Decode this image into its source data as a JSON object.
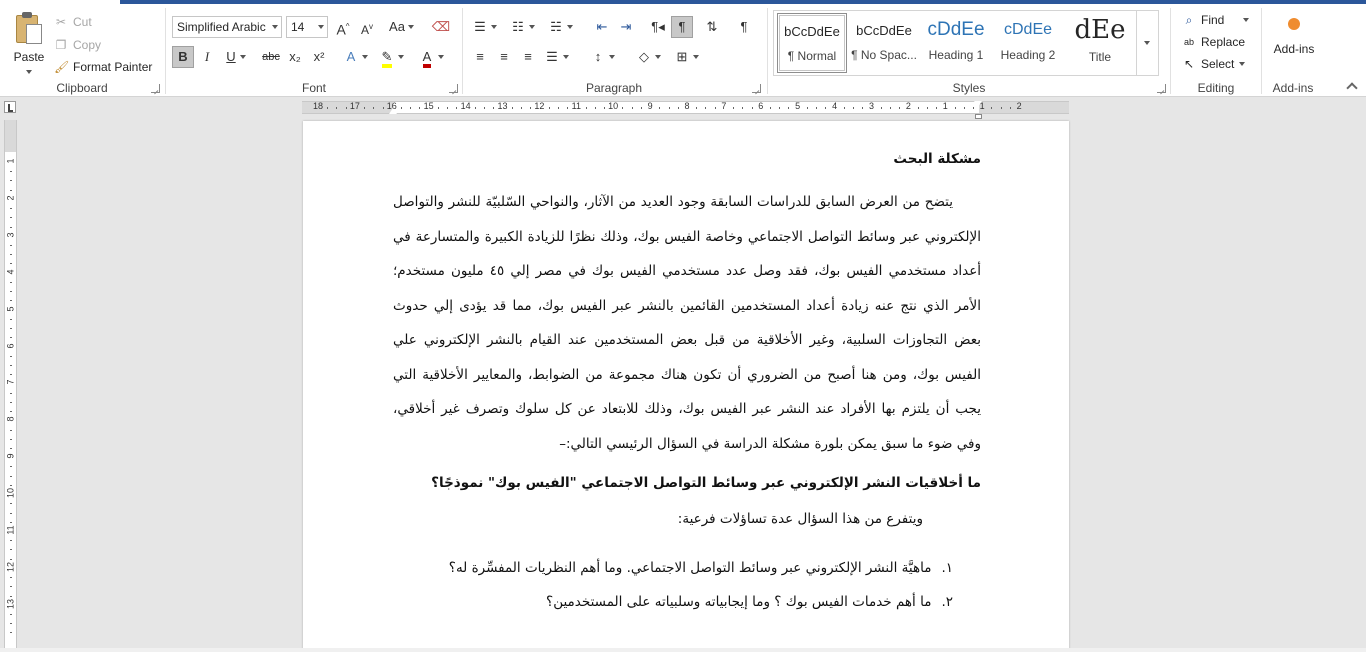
{
  "clipboard": {
    "paste_label": "Paste",
    "cut_label": "Cut",
    "copy_label": "Copy",
    "format_painter_label": "Format Painter",
    "group_label": "Clipboard"
  },
  "font": {
    "family": "Simplified Arabic",
    "size": "14",
    "group_label": "Font",
    "grow_icon": "A^",
    "shrink_icon": "Av",
    "case_label": "Aa",
    "bold": "B",
    "italic": "I",
    "underline": "U",
    "strike": "abc",
    "subscript": "x₂",
    "superscript": "x²",
    "highlight_color": "#ffff00",
    "font_color": "#c00000"
  },
  "paragraph": {
    "group_label": "Paragraph"
  },
  "styles": {
    "group_label": "Styles",
    "items": [
      {
        "sample": "bCcDdEe",
        "name": "¶ Normal"
      },
      {
        "sample": "bCcDdEe",
        "name": "¶ No Spac..."
      },
      {
        "sample": "cDdEe",
        "name": "Heading 1"
      },
      {
        "sample": "cDdEe",
        "name": "Heading 2"
      },
      {
        "sample": "dEe",
        "name": "Title"
      }
    ]
  },
  "editing": {
    "group_label": "Editing",
    "find_label": "Find",
    "replace_label": "Replace",
    "select_label": "Select"
  },
  "addins": {
    "button_label": "Add-ins",
    "group_label": "Add-ins"
  },
  "ruler": {
    "numbers": [
      "18",
      "17",
      "16",
      "15",
      "14",
      "13",
      "12",
      "11",
      "10",
      "9",
      "8",
      "7",
      "6",
      "5",
      "4",
      "3",
      "2",
      "1",
      "1",
      "2"
    ],
    "vnumbers": [
      "1",
      "2",
      "3",
      "4",
      "5",
      "6",
      "7",
      "8",
      "9",
      "10",
      "11",
      "12",
      "13"
    ]
  },
  "document": {
    "title": "مشكلة البحث",
    "paragraph": "يتضح من العرض السابق للدراسات السابقة وجود العديد من الآثار، والنواحي السّلبيّة للنشر والتواصل الإلكتروني عبر وسائط التواصل الاجتماعي وخاصة الفيس بوك، وذلك نظرًا للزيادة الكبيرة والمتسارعة في أعداد مستخدمي الفيس بوك، فقد وصل عدد مستخدمي الفيس بوك في مصر إلي ٤٥ مليون مستخدم؛ الأمر الذي نتج عنه زيادة أعداد المستخدمين القائمين بالنشر عبر الفيس بوك، مما قد يؤدى إلي حدوث بعض التجاوزات السلبية، وغير الأخلاقية من قبل بعض المستخدمين عند القيام بالنشر الإلكتروني علي الفيس بوك، ومن هنا أصبح من الضروري أن تكون هناك مجموعة من الضوابط، والمعايير الأخلاقية التي يجب أن يلتزم بها الأفراد عند النشر عبر الفيس بوك، وذلك للابتعاد عن كل سلوك وتصرف غير أخلاقي، وفي ضوء ما سبق يمكن بلورة مشكلة الدراسة في السؤال الرئيسي التالي:–",
    "question": "ما أخلاقيات النشر الإلكتروني عبر وسائط التواصل الاجتماعي \"الفيس بوك\" نموذجًا؟",
    "sub_intro": "ويتفرع من هذا السؤال عدة تساؤلات فرعية:",
    "list": [
      {
        "num": "١.",
        "text": "ماهيَّة النشر الإلكتروني عبر وسائط التواصل الاجتماعي. وما أهم النظريات المفسِّرة له؟"
      },
      {
        "num": "٢.",
        "text": "ما أهم خدمات الفيس بوك ؟ وما إيجابياته وسلبياته على المستخدمين؟"
      }
    ]
  },
  "colors": {
    "accent": "#2b579a",
    "addins_dot": "#ef8c2f"
  }
}
